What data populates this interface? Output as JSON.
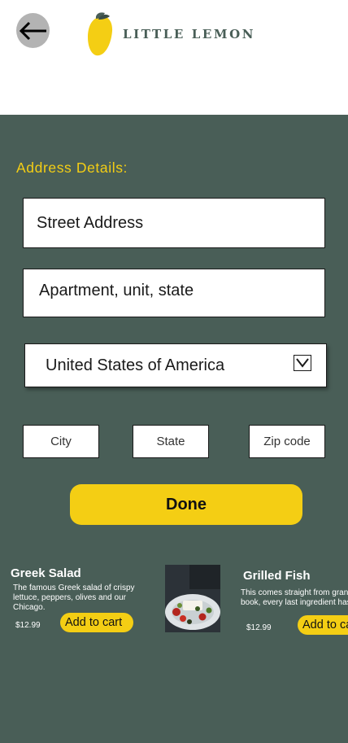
{
  "header": {
    "brand": "LITTLE LEMON",
    "back_icon": "arrow-left-icon",
    "colors": {
      "brand_text": "#495e57",
      "back_bg": "#b3b3b3"
    }
  },
  "form": {
    "title": "Address Details:",
    "street_placeholder": "Street Address",
    "apartment_placeholder": "Apartment, unit, state",
    "country_value": "United States of America",
    "city_placeholder": "City",
    "state_placeholder": "State",
    "zip_placeholder": "Zip code",
    "done_label": "Done"
  },
  "menu": {
    "items": [
      {
        "name": "Greek Salad",
        "description": "The famous Greek salad of crispy lettuce, peppers, olives and our Chicago.",
        "price": "$12.99",
        "cart_label": "Add to cart"
      },
      {
        "name": "Grilled Fish",
        "description": "This comes straight from grandma's recipe book, every last ingredient has been",
        "price": "$12.99",
        "cart_label": "Add to cart"
      }
    ]
  },
  "colors": {
    "primary": "#495e57",
    "accent": "#f4ce14",
    "white": "#ffffff"
  }
}
